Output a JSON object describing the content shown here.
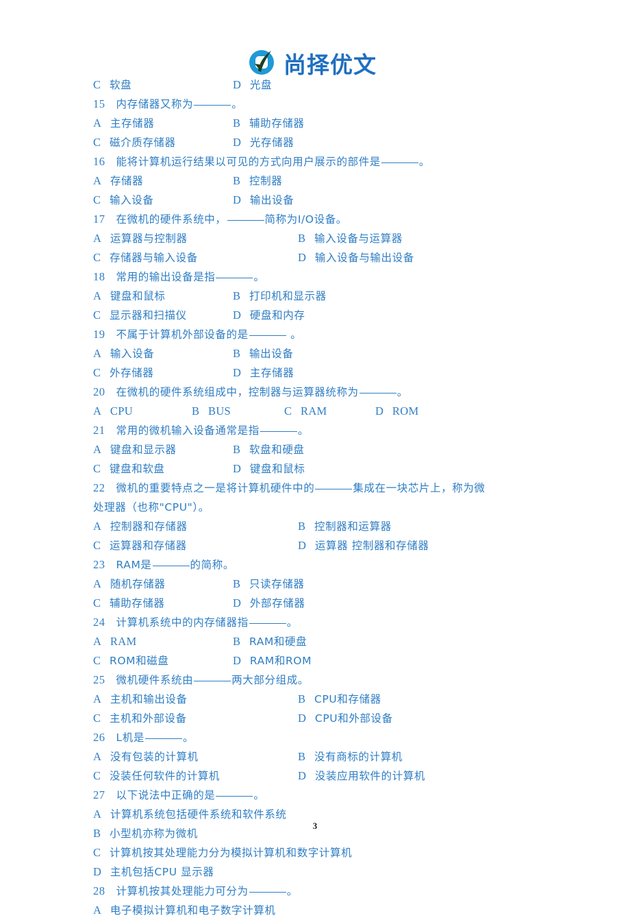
{
  "brand": {
    "logo_icon": "check-circle-logo-icon",
    "name": "尚择优文",
    "circle_color": "#1F9AD6",
    "check_color": "#1e4020",
    "text_color": "#1f6fc0"
  },
  "document": {
    "text_color": "#2f7ec4",
    "page_number": "3"
  },
  "content": {
    "orphan_options": [
      {
        "letter": "C",
        "text": "软盘"
      },
      {
        "letter": "D",
        "text": "光盘"
      }
    ],
    "questions": [
      {
        "number": "15",
        "stem_before": "内存储器又称为",
        "stem_after": "。",
        "layout": "2col-narrow",
        "options": [
          {
            "letter": "A",
            "text": "主存储器"
          },
          {
            "letter": "B",
            "text": "辅助存储器"
          },
          {
            "letter": "C",
            "text": "磁介质存储器"
          },
          {
            "letter": "D",
            "text": "光存储器"
          }
        ]
      },
      {
        "number": "16",
        "stem_before": "能将计算机运行结果以可见的方式向用户展示的部件是",
        "stem_after": "。",
        "layout": "2col-narrow",
        "options": [
          {
            "letter": "A",
            "text": "存储器"
          },
          {
            "letter": "B",
            "text": "控制器"
          },
          {
            "letter": "C",
            "text": "输入设备"
          },
          {
            "letter": "D",
            "text": "输出设备"
          }
        ]
      },
      {
        "number": "17",
        "stem_before": "在微机的硬件系统中，",
        "stem_after": "简称为I/O设备。",
        "layout": "2col-wide",
        "options": [
          {
            "letter": "A",
            "text": "运算器与控制器"
          },
          {
            "letter": "B",
            "text": "输入设备与运算器"
          },
          {
            "letter": "C",
            "text": "存储器与输入设备"
          },
          {
            "letter": "D",
            "text": "输入设备与输出设备"
          }
        ]
      },
      {
        "number": "18",
        "stem_before": "常用的输出设备是指",
        "stem_after": "。",
        "layout": "2col-narrow",
        "options": [
          {
            "letter": "A",
            "text": "键盘和鼠标"
          },
          {
            "letter": "B",
            "text": "打印机和显示器"
          },
          {
            "letter": "C",
            "text": "显示器和扫描仪"
          },
          {
            "letter": "D",
            "text": "硬盘和内存"
          }
        ]
      },
      {
        "number": "19",
        "stem_before": "不属于计算机外部设备的是",
        "stem_after": " 。",
        "layout": "2col-narrow",
        "options": [
          {
            "letter": "A",
            "text": "输入设备"
          },
          {
            "letter": "B",
            "text": "输出设备"
          },
          {
            "letter": "C",
            "text": "外存储器"
          },
          {
            "letter": "D",
            "text": "主存储器"
          }
        ]
      },
      {
        "number": "20",
        "stem_before": "在微机的硬件系统组成中，控制器与运算器统称为",
        "stem_after": "。",
        "layout": "4col",
        "options": [
          {
            "letter": "A",
            "text": "CPU"
          },
          {
            "letter": "B",
            "text": "BUS"
          },
          {
            "letter": "C",
            "text": "RAM"
          },
          {
            "letter": "D",
            "text": "ROM"
          }
        ]
      },
      {
        "number": "21",
        "stem_before": "常用的微机输入设备通常是指",
        "stem_after": "。",
        "layout": "2col-narrow",
        "options": [
          {
            "letter": "A",
            "text": "键盘和显示器"
          },
          {
            "letter": "B",
            "text": "软盘和硬盘"
          },
          {
            "letter": "C",
            "text": "键盘和软盘"
          },
          {
            "letter": "D",
            "text": "键盘和鼠标"
          }
        ]
      },
      {
        "number": "22",
        "stem_before": "微机的重要特点之一是将计算机硬件中的",
        "stem_after": "集成在一块芯片上，称为微",
        "stem_line2": "处理器（也称\"CPU\"）。",
        "layout": "2col-wide",
        "options": [
          {
            "letter": "A",
            "text": "控制器和存储器"
          },
          {
            "letter": "B",
            "text": "控制器和运算器"
          },
          {
            "letter": "C",
            "text": "运算器和存储器"
          },
          {
            "letter": "D",
            "text": "运算器  控制器和存储器"
          }
        ]
      },
      {
        "number": "23",
        "stem_before": "RAM是",
        "stem_after": "的简称。",
        "layout": "2col-narrow",
        "options": [
          {
            "letter": "A",
            "text": "随机存储器"
          },
          {
            "letter": "B",
            "text": "只读存储器"
          },
          {
            "letter": "C",
            "text": "辅助存储器"
          },
          {
            "letter": "D",
            "text": "外部存储器"
          }
        ]
      },
      {
        "number": "24",
        "stem_before": "计算机系统中的内存储器指",
        "stem_after": "。",
        "layout": "2col-narrow",
        "options": [
          {
            "letter": "A",
            "text": "RAM"
          },
          {
            "letter": "B",
            "text": "RAM和硬盘"
          },
          {
            "letter": "C",
            "text": "ROM和磁盘"
          },
          {
            "letter": "D",
            "text": "RAM和ROM"
          }
        ]
      },
      {
        "number": "25",
        "stem_before": "微机硬件系统由",
        "stem_after": "两大部分组成。",
        "layout": "2col-wide",
        "options": [
          {
            "letter": "A",
            "text": "主机和输出设备"
          },
          {
            "letter": "B",
            "text": "CPU和存储器"
          },
          {
            "letter": "C",
            "text": "主机和外部设备"
          },
          {
            "letter": "D",
            "text": "CPU和外部设备"
          }
        ]
      },
      {
        "number": "26",
        "stem_before": "L机是",
        "stem_after": "。",
        "layout": "2col-wide",
        "options": [
          {
            "letter": "A",
            "text": "没有包装的计算机"
          },
          {
            "letter": "B",
            "text": "没有商标的计算机"
          },
          {
            "letter": "C",
            "text": "没装任何软件的计算机"
          },
          {
            "letter": "D",
            "text": "没装应用软件的计算机"
          }
        ]
      },
      {
        "number": "27",
        "stem_before": "以下说法中正确的是",
        "stem_after": "。",
        "layout": "1col",
        "options": [
          {
            "letter": "A",
            "text": "计算机系统包括硬件系统和软件系统"
          },
          {
            "letter": "B",
            "text": "小型机亦称为微机"
          },
          {
            "letter": "C",
            "text": "计算机按其处理能力分为模拟计算机和数字计算机"
          },
          {
            "letter": "D",
            "text": "主机包括CPU  显示器"
          }
        ]
      },
      {
        "number": "28",
        "stem_before": "计算机按其处理能力可分为",
        "stem_after": "。",
        "layout": "1col",
        "options": [
          {
            "letter": "A",
            "text": "电子模拟计算机和电子数字计算机"
          }
        ]
      }
    ]
  }
}
